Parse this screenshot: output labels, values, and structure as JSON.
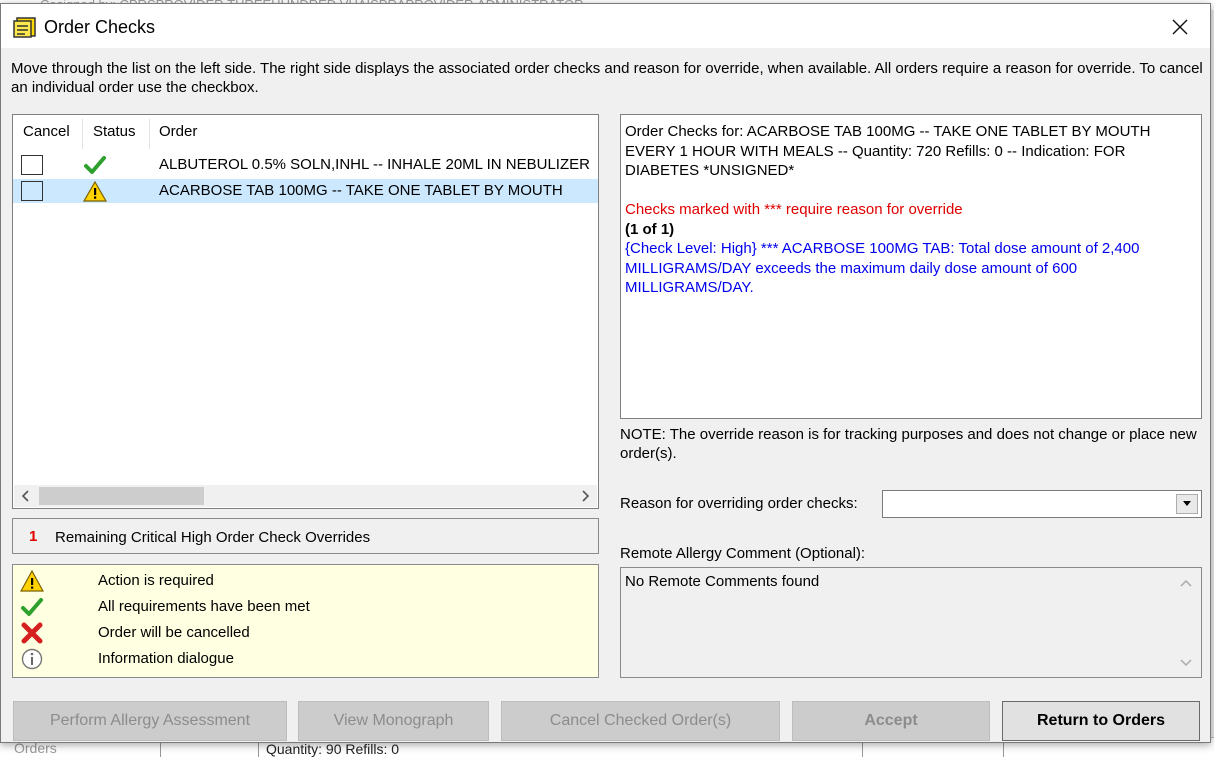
{
  "background": {
    "top_text": "Cosigned by: CPRSPROVIDER,THREEHUNDRED  VHAISPRAPROVIDER,ADMINISTRATOR",
    "bottom_left": "Orders",
    "bottom_text": "Quantity: 90 Refills: 0"
  },
  "window": {
    "title": "Order Checks",
    "close_icon": "close-icon"
  },
  "instruction": "Move through the list on the left side. The right side displays the associated order checks and reason for override, when available. All orders require a reason for override. To cancel an individual order use the checkbox.",
  "orders_table": {
    "columns": [
      "Cancel",
      "Status",
      "Order"
    ],
    "rows": [
      {
        "status_icon": "checkmark-icon",
        "order": "ALBUTEROL 0.5% SOLN,INHL  -- INHALE 20ML IN NEBULIZER",
        "selected": false,
        "cancel_checked": false
      },
      {
        "status_icon": "warning-icon",
        "order": "ACARBOSE TAB  100MG -- TAKE ONE TABLET BY MOUTH",
        "selected": true,
        "cancel_checked": false
      }
    ]
  },
  "remaining": {
    "count": "1",
    "label": "Remaining Critical High Order Check Overrides"
  },
  "legend": [
    {
      "icon": "warning-icon",
      "text": "Action is required"
    },
    {
      "icon": "checkmark-icon",
      "text": "All requirements have been met"
    },
    {
      "icon": "red-x-icon",
      "text": "Order will be cancelled"
    },
    {
      "icon": "info-icon",
      "text": "Information dialogue"
    }
  ],
  "order_checks": {
    "header": "Order Checks for: ACARBOSE TAB  100MG -- TAKE ONE TABLET BY MOUTH EVERY 1 HOUR WITH MEALS -- Quantity: 720 Refills: 0 -- Indication: FOR DIABETES *UNSIGNED*",
    "warning": "Checks marked with *** require reason for override",
    "counter": "(1 of 1)",
    "detail": "{Check Level: High}  *** ACARBOSE 100MG TAB: Total dose amount of 2,400 MILLIGRAMS/DAY exceeds the maximum daily dose amount of 600 MILLIGRAMS/DAY."
  },
  "note": "NOTE: The override reason is for tracking purposes and does not change or place new order(s).",
  "reason": {
    "label": "Reason for overriding order checks:",
    "value": ""
  },
  "remote_comment": {
    "label": "Remote Allergy Comment (Optional):",
    "value": "No Remote Comments found"
  },
  "buttons": {
    "perform_allergy": "Perform Allergy Assessment",
    "view_monograph": "View Monograph",
    "cancel_checked": "Cancel Checked Order(s)",
    "accept": "Accept",
    "return": "Return to Orders"
  },
  "colors": {
    "selection": "#cce8ff",
    "legend_bg": "#ffffe1",
    "critical_red": "#e00000",
    "detail_blue": "#0000ee"
  }
}
